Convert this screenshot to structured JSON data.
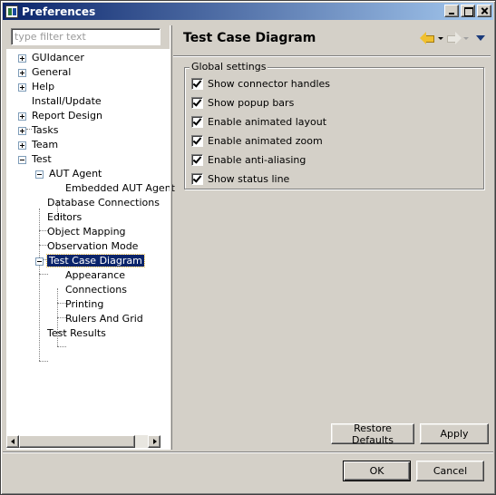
{
  "window": {
    "title": "Preferences"
  },
  "filter": {
    "placeholder": "type filter text",
    "value": ""
  },
  "tree": {
    "items": [
      {
        "label": "GUIdancer",
        "expander": "plus"
      },
      {
        "label": "General",
        "expander": "plus"
      },
      {
        "label": "Help",
        "expander": "plus"
      },
      {
        "label": "Install/Update",
        "expander": "none"
      },
      {
        "label": "Report Design",
        "expander": "plus"
      },
      {
        "label": "Tasks",
        "expander": "plus"
      },
      {
        "label": "Team",
        "expander": "plus"
      },
      {
        "label": "Test",
        "expander": "minus"
      },
      {
        "label": "AUT Agent",
        "expander": "minus"
      },
      {
        "label": "Embedded AUT Agent",
        "expander": "none"
      },
      {
        "label": "Database Connections",
        "expander": "none"
      },
      {
        "label": "Editors",
        "expander": "none"
      },
      {
        "label": "Object Mapping",
        "expander": "none"
      },
      {
        "label": "Observation Mode",
        "expander": "none"
      },
      {
        "label": "Test Case Diagram",
        "expander": "minus",
        "selected": true
      },
      {
        "label": "Appearance",
        "expander": "none"
      },
      {
        "label": "Connections",
        "expander": "none"
      },
      {
        "label": "Printing",
        "expander": "none"
      },
      {
        "label": "Rulers And Grid",
        "expander": "none"
      },
      {
        "label": "Test Results",
        "expander": "none"
      }
    ]
  },
  "page": {
    "title": "Test Case Diagram",
    "group_label": "Global settings",
    "options": [
      {
        "label": "Show connector handles",
        "checked": true
      },
      {
        "label": "Show popup bars",
        "checked": true
      },
      {
        "label": "Enable animated layout",
        "checked": true
      },
      {
        "label": "Enable animated zoom",
        "checked": true
      },
      {
        "label": "Enable anti-aliasing",
        "checked": true
      },
      {
        "label": "Show status line",
        "checked": true
      }
    ],
    "restore_defaults_label": "Restore Defaults",
    "apply_label": "Apply"
  },
  "dialog": {
    "ok_label": "OK",
    "cancel_label": "Cancel"
  },
  "colors": {
    "selection": "#0a246a",
    "titlebar_start": "#0a246a",
    "titlebar_end": "#a6caf0",
    "face": "#d4d0c8"
  }
}
